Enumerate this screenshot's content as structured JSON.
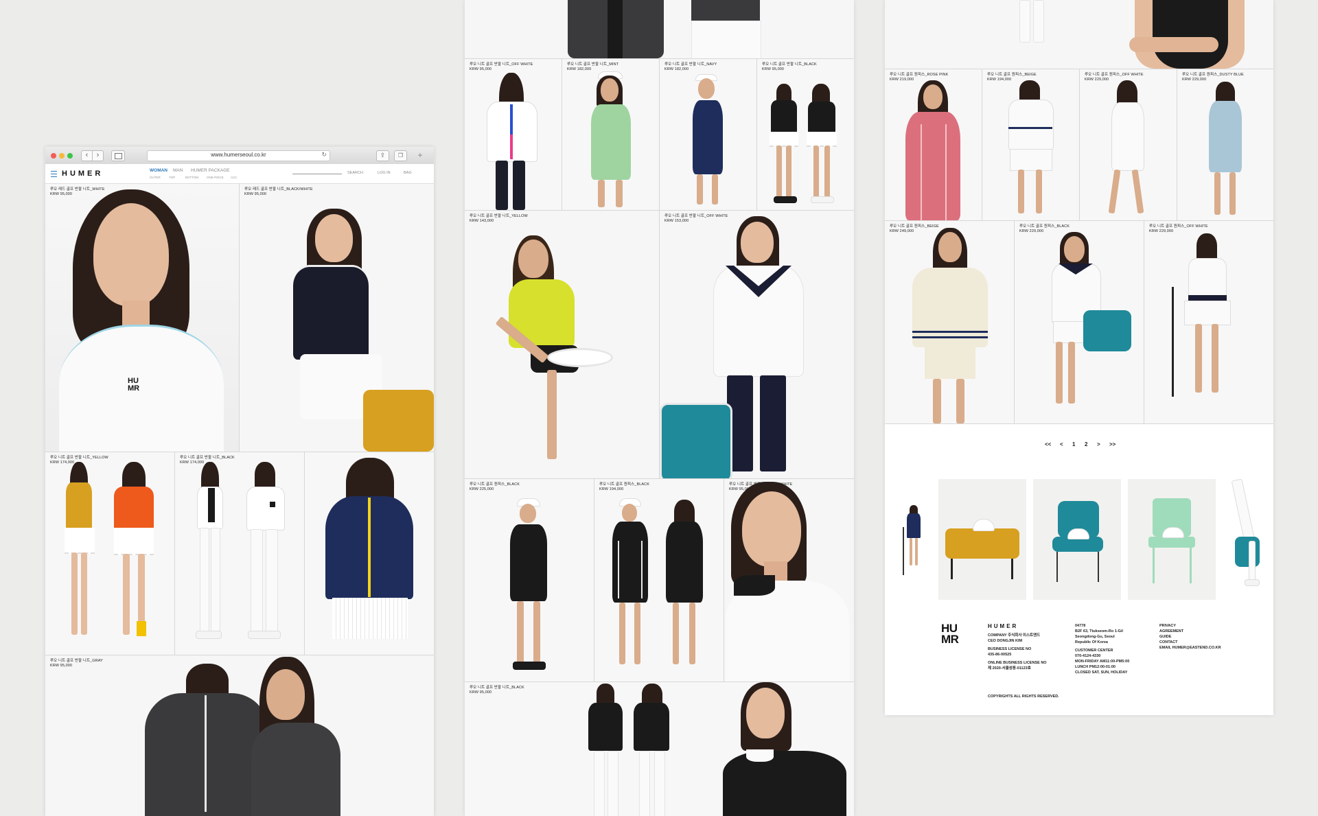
{
  "browser": {
    "url": "www.humerseoul.co.kr"
  },
  "brand": {
    "name": "HUMER",
    "logo_mark": [
      "HU",
      "MR"
    ],
    "chest_logo": [
      "HU",
      "MR"
    ]
  },
  "nav": {
    "items": [
      {
        "label": "WOMAN",
        "active": true
      },
      {
        "label": "MAN",
        "active": false
      },
      {
        "label": "HUMER PACKAGE",
        "active": false
      }
    ],
    "subitems": [
      "OUTER",
      "TOP",
      "BOTTOM",
      "ONE-PIECE",
      "ACC"
    ],
    "search": "SEARCH",
    "login": "LOG IN",
    "bag": "BAG"
  },
  "products": {
    "p1": {
      "name": "루오 레드 골프 반팔 니트_WHITE",
      "price": "KRW 95,000"
    },
    "p2": {
      "name": "루오 레드 골프 반팔 니트_BLACK/WHITE",
      "price": "KRW 95,000"
    },
    "p3": {
      "name": "루오 니트 골프 반팔 니트_YELLOW",
      "price": "KRW 174,000"
    },
    "p4": {
      "name": "루오 니트 골프 반팔 니트_BLACK",
      "price": "KRW 174,000"
    },
    "p5": {
      "name": "루오 니트 골프 반팔 니트_GRAY",
      "price": "KRW 95,000"
    },
    "p6": {
      "name": "루오 니트 골프 반팔 니트_OFF WHITE",
      "price": "KRW 95,000"
    },
    "p7": {
      "name": "루오 니트 골프 반팔 니트_MINT",
      "price": "KRW 182,000"
    },
    "p8": {
      "name": "루오 니트 골프 반팔 니트_NAVY",
      "price": "KRW 182,000"
    },
    "p9": {
      "name": "루오 니트 골프 반팔 니트_BLACK",
      "price": "KRW 95,000"
    },
    "p10": {
      "name": "루오 니트 골프 반팔 니트_YELLOW",
      "price": "KRW 143,000"
    },
    "p11": {
      "name": "루오 니트 골프 반팔 니트_OFF WHITE",
      "price": "KRW 153,000"
    },
    "p12": {
      "name": "루오 니트 골프 원피스_BLACK",
      "price": "KRW 225,000"
    },
    "p13": {
      "name": "루오 니트 골프 원피스_BLACK",
      "price": "KRW 194,000"
    },
    "p14": {
      "name": "루오 니트 골프 반팔 니트_OFF WHITE",
      "price": "KRW 95,000"
    },
    "p15": {
      "name": "루오 니트 골프 반팔 니트_BLACK",
      "price": "KRW 95,000"
    },
    "p16": {
      "name": "루오 니트 골프 원피스_ROSE PINK",
      "price": "KRW 219,000"
    },
    "p17": {
      "name": "루오 니트 골프 원피스_BEIGE",
      "price": "KRW 194,000"
    },
    "p18": {
      "name": "루오 니트 골프 원피스_OFF WHITE",
      "price": "KRW 229,000"
    },
    "p19": {
      "name": "루오 니트 골프 원피스_DUSTY BLUE",
      "price": "KRW 229,000"
    },
    "p20": {
      "name": "루오 니트 골프 원피스_BEIGE",
      "price": "KRW 249,000"
    },
    "p21": {
      "name": "루오 니트 골프 원피스_BLACK",
      "price": "KRW 229,000"
    },
    "p22": {
      "name": "루오 니트 골프 원피스_OFF WHITE",
      "price": "KRW 229,000"
    }
  },
  "pagination": {
    "first": "<<",
    "prev": "<",
    "page1": "1",
    "page2": "2",
    "next": ">",
    "last": ">>"
  },
  "footer": {
    "company_lines": [
      "COMPANY 주식회사 이스트엔드",
      "CEO DONGJIN KIM",
      "",
      "BUSINESS LICENSE NO",
      "435-86-00525",
      "",
      "ONLINE BUSINESS LICENSE NO",
      "제 2020-서울성동-01123호"
    ],
    "address_lines": [
      "04778",
      "B2F 63, Ttukseom-Ro 1-Gil",
      "Seongdong-Gu, Seoul",
      "Republic Of Korea",
      "",
      "CUSTOMER CENTER",
      "070-4124-4330",
      "MON-FRIDAY AM11:00-PM5:00",
      "LUNCH PM12:00-01:00",
      "CLOSED SAT, SUN, HOLIDAY"
    ],
    "links": [
      "PRIVACY",
      "AGREEMENT",
      "GUIDE",
      "CONTACT",
      "EMAIL HUMER@EASTEND.CO.KR"
    ],
    "copyright": "COPYRIGHTS ALL RIGHTS RESERVED."
  },
  "colors": {
    "background": "#ececeb",
    "navy": "#1f2d5c",
    "black": "#1a1a1a",
    "mustard": "#d8a020",
    "teal": "#1f8a9a",
    "mint": "#9fdcbc",
    "orange": "#ee5a1c",
    "lime": "#d7e02c",
    "pink": "#dc6f7c",
    "dusty_blue": "#a9c6d6",
    "green": "#9fd4a0",
    "cream": "#f0ead8",
    "skin": "#e4bb9d",
    "hair": "#2b1e19"
  }
}
